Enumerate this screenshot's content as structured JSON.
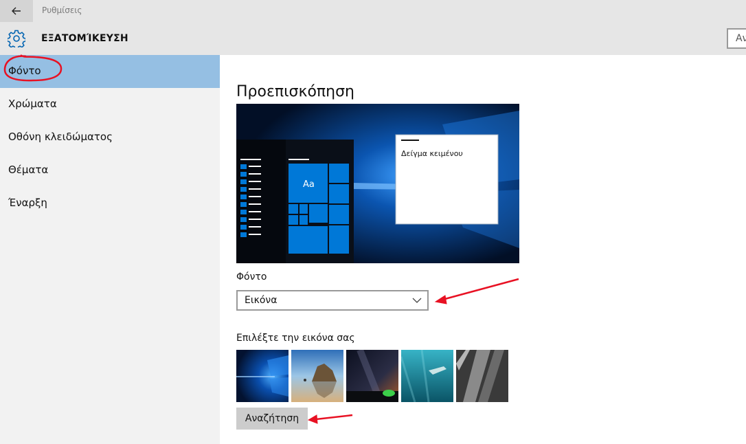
{
  "window": {
    "title": "Ρυθμίσεις"
  },
  "header": {
    "section_title": "ΕΞΑΤΟΜΊΚΕΥΣΗ",
    "search_placeholder": "Αν"
  },
  "sidebar": {
    "items": [
      {
        "label": "Φόντο",
        "active": true
      },
      {
        "label": "Χρώματα"
      },
      {
        "label": "Οθόνη κλειδώματος"
      },
      {
        "label": "Θέματα"
      },
      {
        "label": "Έναρξη"
      }
    ]
  },
  "main": {
    "heading": "Προεπισκόπηση",
    "preview": {
      "sample_text": "Δείγμα κειμένου",
      "tile_text": "Aa"
    },
    "background_label": "Φόντο",
    "background_value": "Εικόνα",
    "choose_picture_label": "Επιλέξτε την εικόνα σας",
    "browse_label": "Αναζήτηση",
    "thumbnails": [
      {
        "name": "windows-10-hero"
      },
      {
        "name": "beach-rocks"
      },
      {
        "name": "night-sky-tent"
      },
      {
        "name": "underwater-swimmer"
      },
      {
        "name": "rock-face"
      }
    ]
  },
  "colors": {
    "accent": "#0078d7",
    "active_nav": "#95bfe3",
    "annotation": "#e81123"
  }
}
